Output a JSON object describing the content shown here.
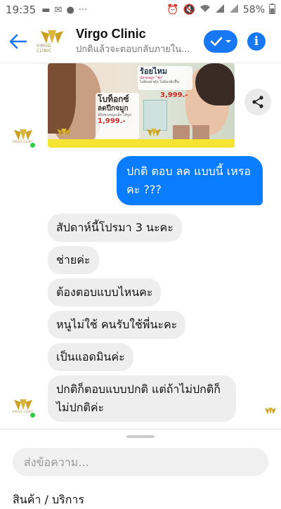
{
  "status_bar": {
    "time": "19:35",
    "icons_left": [
      "message-icon",
      "mail-icon",
      "line-icon",
      "more-dots"
    ],
    "icons_right": [
      "alarm-icon",
      "no-sound-icon",
      "wifi-icon",
      "signal-icon",
      "signal-icon-2"
    ],
    "battery": "58%"
  },
  "header": {
    "logo_text": "VIRGO CLINIC",
    "name": "Virgo Clinic",
    "subtitle": "ปกติแล้วจะตอบกลับภายใน..."
  },
  "banner": {
    "left_title": "โบท็อกซ์",
    "left_subtitle": "ลดปีกจมูก",
    "left_note": "ปรับทรงจมูกเล็ก ได้รูป",
    "left_price": "1,999.-",
    "right_title": "ร้อยไหม",
    "right_highlight": "ปลายจมูก \"พุ่ง\"",
    "right_note": "ไม่ต้องผ่าตัด ไม่ต้องพักฟื้น",
    "right_price": "3,999.-"
  },
  "messages": {
    "outgoing": "ปกติ ตอบ ลค แบบนี้ เหรอคะ ???",
    "incoming": [
      "สัปดาห์นี้โปรมา 3 นะคะ",
      "ช่ายค่ะ",
      "ต้องตอบแบบไหนคะ",
      "หนูไม่ใช้ คนรับใช้พี่นะคะ",
      "เป็นแอดมินค่ะ",
      "ปกติก็ตอบแบบปกติ แต่ถ้าไม่ปกติก็ไม่ปกติค่ะ"
    ]
  },
  "composer": {
    "placeholder": "ส่งข้อความ...",
    "products_label": "สินค้า / บริการ"
  },
  "colors": {
    "accent": "#0a7cff",
    "brand_gold": "#c9a227",
    "incoming_bubble": "#eeeeee",
    "online": "#31cc46"
  }
}
